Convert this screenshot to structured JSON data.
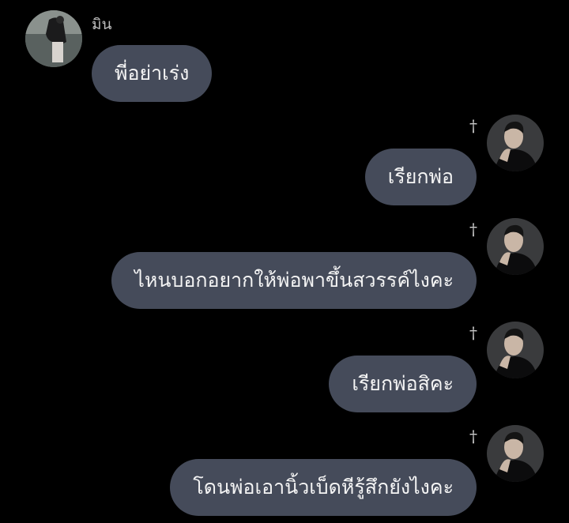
{
  "colors": {
    "background": "#000000",
    "bubble": "#454b5a",
    "text": "#f4f4f4",
    "name": "#bdbdbd"
  },
  "sender": {
    "name": "มิน",
    "avatar_icon": "woman-at-seaside-avatar"
  },
  "me": {
    "avatar_icon": "man-in-black-avatar",
    "mark_glyph": "†"
  },
  "messages": [
    {
      "side": "in",
      "text": "พี่อย่าเร่ง"
    },
    {
      "side": "out",
      "text": "เรียกพ่อ"
    },
    {
      "side": "out",
      "text": "ไหนบอกอยากให้พ่อพาขึ้นสวรรค์ไงคะ"
    },
    {
      "side": "out",
      "text": "เรียกพ่อสิคะ"
    },
    {
      "side": "out",
      "text": "โดนพ่อเอานิ้วเบ็ดหีรู้สึกยังไงคะ"
    }
  ]
}
